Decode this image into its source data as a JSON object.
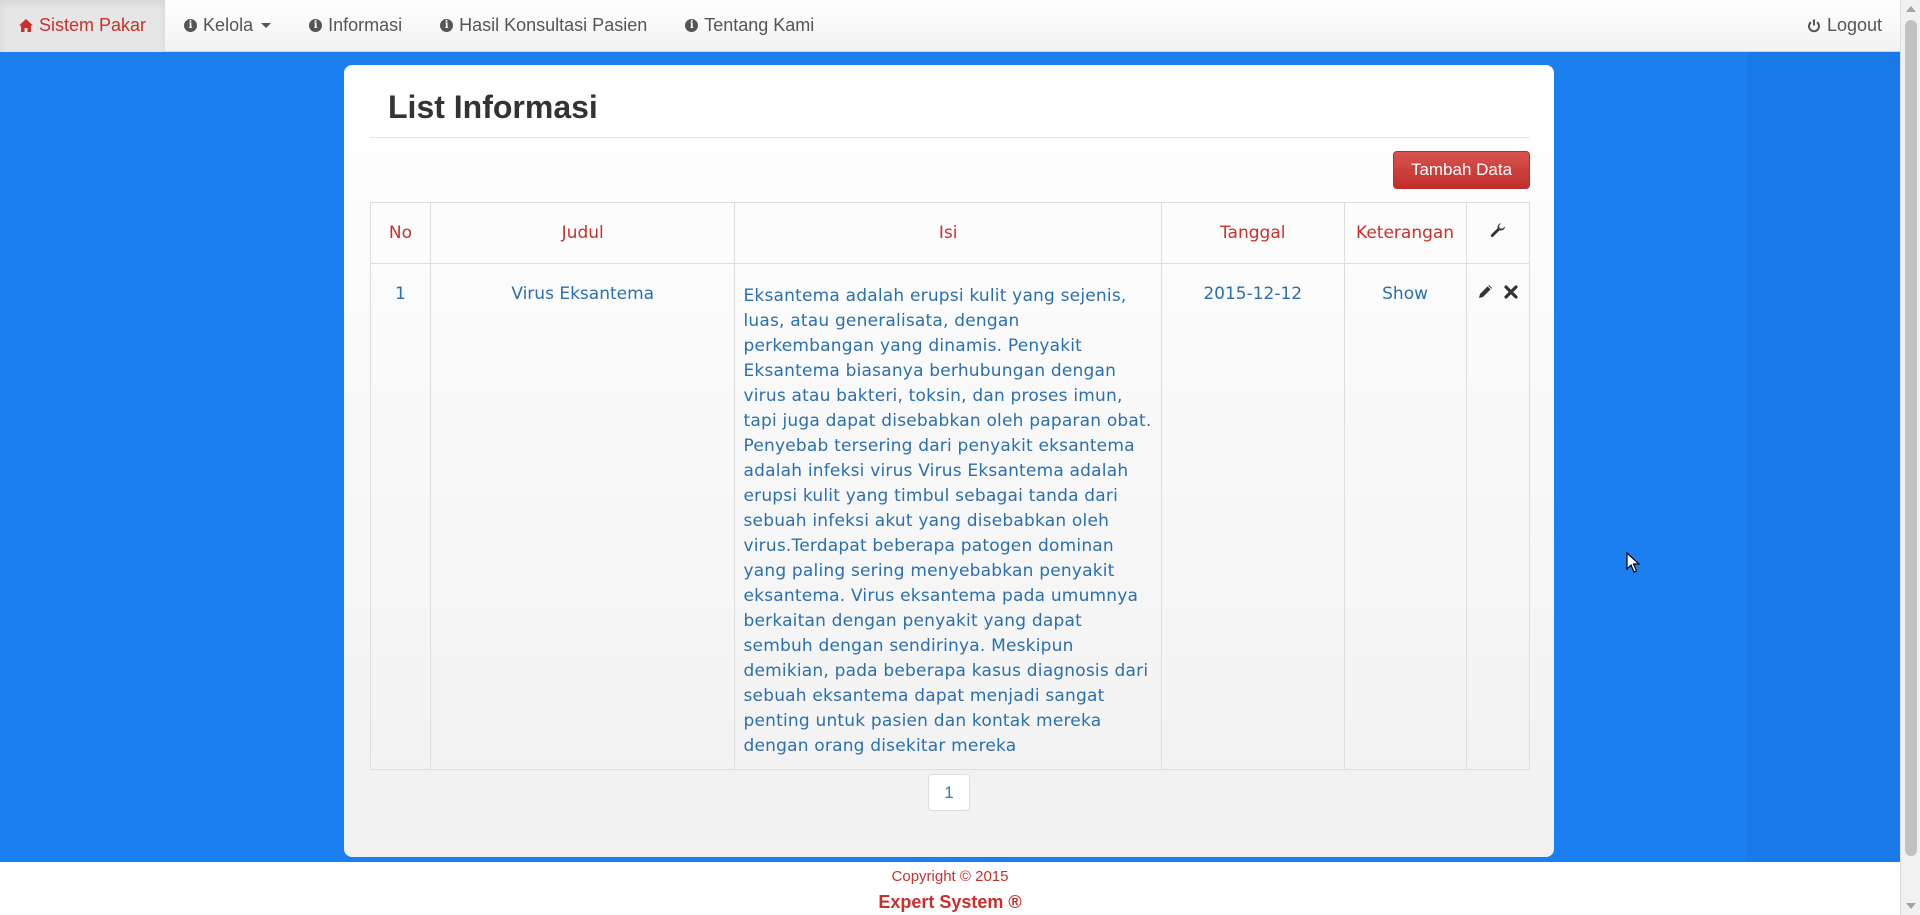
{
  "navbar": {
    "brand": "Sistem Pakar",
    "items": [
      {
        "label": "Kelola",
        "dropdown": true
      },
      {
        "label": "Informasi"
      },
      {
        "label": "Hasil Konsultasi Pasien"
      },
      {
        "label": "Tentang Kami"
      }
    ],
    "logout": "Logout"
  },
  "panel": {
    "title": "List Informasi",
    "add_button": "Tambah Data"
  },
  "table": {
    "headers": [
      "No",
      "Judul",
      "Isi",
      "Tanggal",
      "Keterangan"
    ],
    "rows": [
      {
        "no": "1",
        "judul": "Virus Eksantema",
        "isi": "Eksantema adalah erupsi kulit yang sejenis, luas, atau generalisata, dengan perkembangan yang dinamis. Penyakit Eksantema biasanya berhubungan dengan virus atau bakteri, toksin, dan proses imun, tapi juga dapat disebabkan oleh paparan obat. Penyebab tersering dari penyakit eksantema adalah infeksi virus Virus Eksantema adalah erupsi kulit yang timbul sebagai tanda dari sebuah infeksi akut yang disebabkan oleh virus.Terdapat beberapa patogen dominan yang paling sering menyebabkan penyakit eksantema. Virus eksantema pada umumnya berkaitan dengan penyakit yang dapat sembuh dengan sendirinya. Meskipun demikian, pada beberapa kasus diagnosis dari sebuah eksantema dapat menjadi sangat penting untuk pasien dan kontak mereka dengan orang disekitar mereka",
        "tanggal": "2015-12-12",
        "keterangan": "Show"
      }
    ]
  },
  "pagination": {
    "current": "1"
  },
  "footer": {
    "copyright": "Copyright © 2015",
    "brand": "Expert System ®"
  },
  "colors": {
    "background": "#1b7ff0",
    "accent": "#c9302c",
    "link": "#2a6fb0"
  },
  "icons": {
    "brand": "home-icon",
    "nav": "info-circle-icon",
    "logout": "power-icon",
    "actions_header": "wrench-icon",
    "edit": "pencil-icon",
    "delete": "close-icon"
  }
}
